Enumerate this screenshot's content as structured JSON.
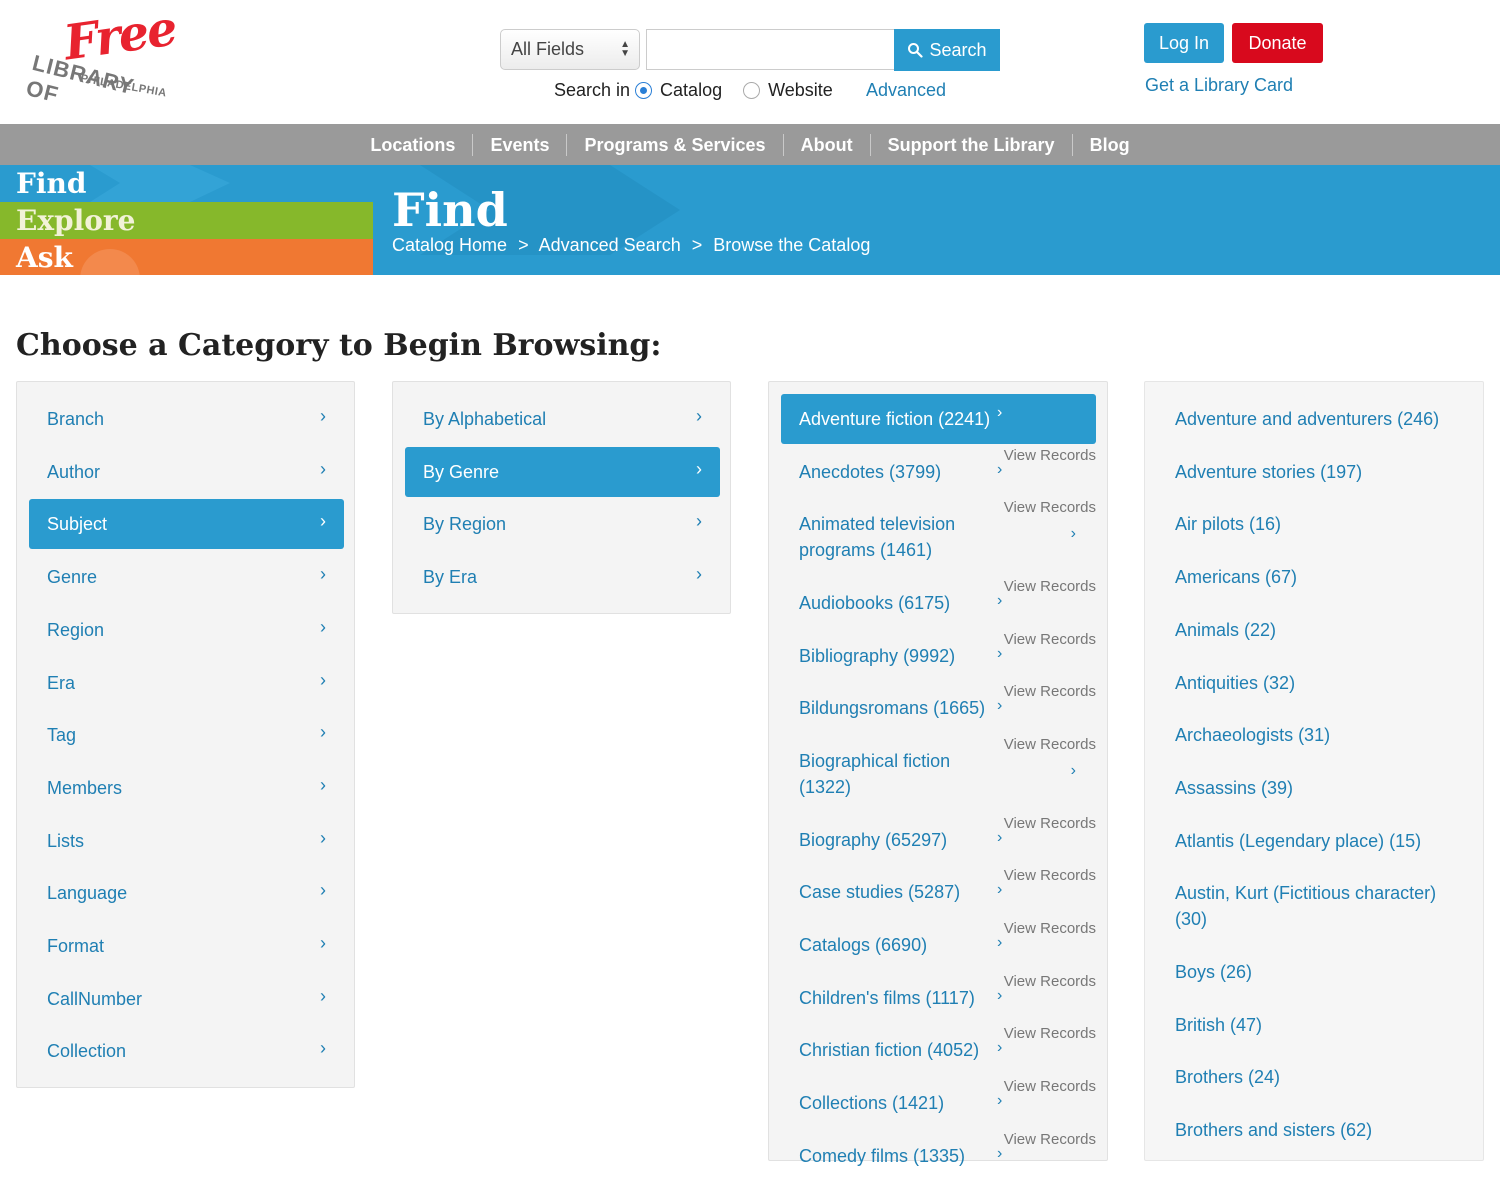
{
  "logo": {
    "free": "Free",
    "library": "LIBRARY OF",
    "city": "PHILADELPHIA"
  },
  "search": {
    "field_select": "All Fields",
    "input_value": "",
    "button_label": "Search",
    "search_in_label": "Search in",
    "option_catalog": "Catalog",
    "option_website": "Website",
    "advanced_label": "Advanced"
  },
  "account": {
    "login_label": "Log In",
    "donate_label": "Donate",
    "card_label": "Get a Library Card"
  },
  "nav": {
    "items": [
      "Locations",
      "Events",
      "Programs & Services",
      "About",
      "Support the Library",
      "Blog"
    ]
  },
  "banner": {
    "tabs": {
      "find": "Find",
      "explore": "Explore",
      "ask": "Ask"
    },
    "title": "Find",
    "breadcrumb": [
      "Catalog Home",
      "Advanced Search",
      "Browse the Catalog"
    ],
    "separator": ">"
  },
  "page_title": "Choose a Category to Begin Browsing:",
  "categories": [
    "Branch",
    "Author",
    "Subject",
    "Genre",
    "Region",
    "Era",
    "Tag",
    "Members",
    "Lists",
    "Language",
    "Format",
    "CallNumber",
    "Collection"
  ],
  "subject_by": [
    "By Alphabetical",
    "By Genre",
    "By Region",
    "By Era"
  ],
  "genres": {
    "view_label": "View Records",
    "items": [
      {
        "line1": "Adventure fiction (2241)",
        "line2": ""
      },
      {
        "line1": "Anecdotes (3799)",
        "line2": ""
      },
      {
        "line1": "Animated television",
        "line2": "programs (1461)"
      },
      {
        "line1": "Audiobooks (6175)",
        "line2": ""
      },
      {
        "line1": "Bibliography (9992)",
        "line2": ""
      },
      {
        "line1": "Bildungsromans (1665)",
        "line2": ""
      },
      {
        "line1": "Biographical fiction",
        "line2": "(1322)"
      },
      {
        "line1": "Biography (65297)",
        "line2": ""
      },
      {
        "line1": "Case studies (5287)",
        "line2": ""
      },
      {
        "line1": "Catalogs (6690)",
        "line2": ""
      },
      {
        "line1": "Children's films (1117)",
        "line2": ""
      },
      {
        "line1": "Christian fiction (4052)",
        "line2": ""
      },
      {
        "line1": "Collections (1421)",
        "line2": ""
      },
      {
        "line1": "Comedy films (1335)",
        "line2": ""
      }
    ]
  },
  "subjects": [
    {
      "line1": "Adventure and adventurers (246)",
      "line2": ""
    },
    {
      "line1": "Adventure stories (197)",
      "line2": ""
    },
    {
      "line1": "Air pilots (16)",
      "line2": ""
    },
    {
      "line1": "Americans (67)",
      "line2": ""
    },
    {
      "line1": "Animals (22)",
      "line2": ""
    },
    {
      "line1": "Antiquities (32)",
      "line2": ""
    },
    {
      "line1": "Archaeologists (31)",
      "line2": ""
    },
    {
      "line1": "Assassins (39)",
      "line2": ""
    },
    {
      "line1": "Atlantis (Legendary place) (15)",
      "line2": ""
    },
    {
      "line1": "Austin, Kurt (Fictitious character)",
      "line2": "(30)"
    },
    {
      "line1": "Boys (26)",
      "line2": ""
    },
    {
      "line1": "British (47)",
      "line2": ""
    },
    {
      "line1": "Brothers (24)",
      "line2": ""
    },
    {
      "line1": "Brothers and sisters (62)",
      "line2": ""
    }
  ],
  "colors": {
    "accent": "#2a9bcf",
    "donate": "#d8091d",
    "nav": "#9a9a9a",
    "explore": "#86b82b",
    "ask": "#f07832"
  }
}
